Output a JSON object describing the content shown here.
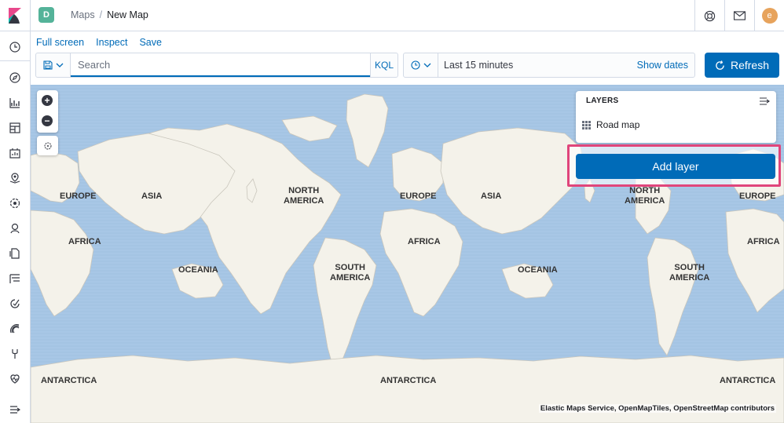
{
  "header": {
    "space_initial": "D",
    "breadcrumb_parent": "Maps",
    "breadcrumb_separator": "/",
    "breadcrumb_current": "New Map",
    "user_initial": "e",
    "colors": {
      "space_badge": "#54b399",
      "avatar": "#e7a35c",
      "accent": "#006bb8"
    }
  },
  "sidenav": {
    "icons": [
      "clock-icon",
      "compass-icon",
      "visualize-icon",
      "dashboard-icon",
      "canvas-icon",
      "maps-icon",
      "ml-icon",
      "infrastructure-icon",
      "logs-icon",
      "apm-icon",
      "uptime-icon",
      "siem-icon",
      "dev-tools-icon",
      "monitoring-icon",
      "management-icon",
      "collapse-icon"
    ]
  },
  "topnav": {
    "full_screen": "Full screen",
    "inspect": "Inspect",
    "save": "Save"
  },
  "query": {
    "placeholder": "Search",
    "language": "KQL",
    "time_range": "Last 15 minutes",
    "show_dates": "Show dates",
    "refresh": "Refresh"
  },
  "layers": {
    "title": "LAYERS",
    "items": [
      {
        "name": "Road map",
        "icon": "grid-icon"
      }
    ],
    "add_layer": "Add layer"
  },
  "map": {
    "labels": {
      "europe1": "EUROPE",
      "asia1": "ASIA",
      "north_america1": "NORTH\nAMERICA",
      "africa1": "AFRICA",
      "oceania1": "OCEANIA",
      "south_america1": "SOUTH\nAMERICA",
      "antarctica1": "ANTARCTICA",
      "europe2": "EUROPE",
      "asia2": "ASIA",
      "north_america2": "NORTH\nAMERICA",
      "africa2": "AFRICA",
      "oceania2": "OCEANIA",
      "south_america2": "SOUTH\nAMERICA",
      "antarctica2": "ANTARCTICA",
      "europe3": "EUROPE",
      "africa3": "AFRICA",
      "antarctica3": "ANTARCTICA"
    },
    "attribution": "Elastic Maps Service, OpenMapTiles, OpenStreetMap contributors",
    "colors": {
      "water": "#a5c4e3",
      "land": "#f4f2ea",
      "border": "#bdbbb5"
    }
  }
}
